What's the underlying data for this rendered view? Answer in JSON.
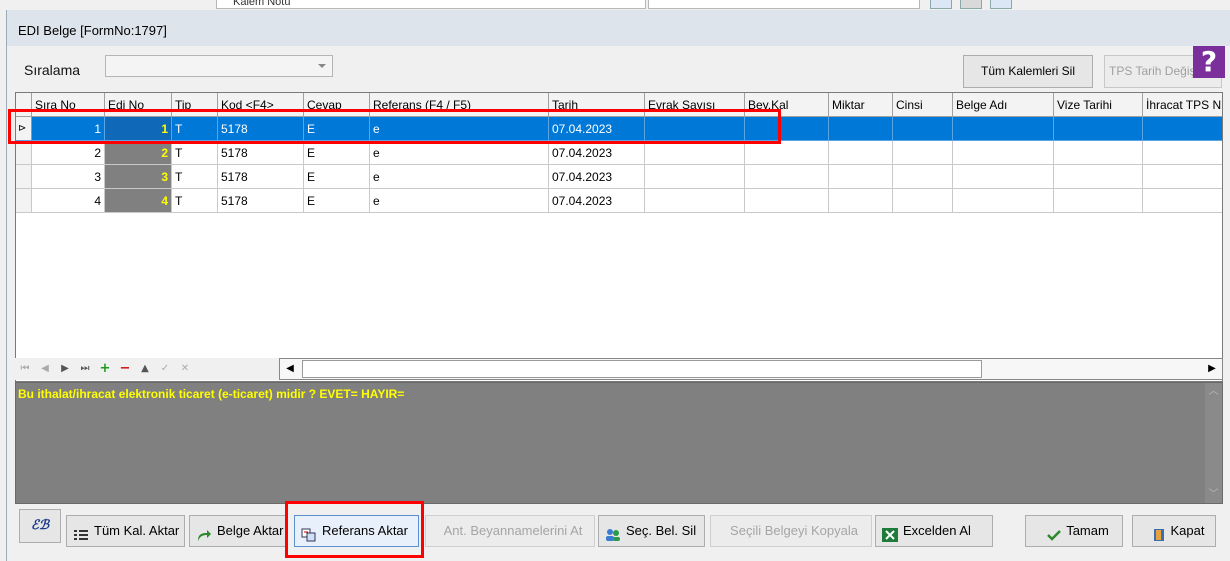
{
  "background_window": {
    "field_label": "Kalem Notu"
  },
  "window": {
    "title": "EDI Belge  [FormNo:1797]"
  },
  "toolbar": {
    "sort_label": "Sıralama",
    "sort_value": "",
    "delete_all_label": "Tüm Kalemleri Sil",
    "tps_label": "TPS Tarih Değiş",
    "help_label": "?"
  },
  "grid": {
    "columns": [
      "Sıra No",
      "Edi No",
      "Tip",
      "Kod <F4>",
      "Cevap",
      "Referans (F4 / F5)",
      "Tarih",
      "Evrak Sayısı",
      "Bey.Kal",
      "Miktar",
      "Cinsi",
      "Belge Adı",
      "Vize Tarihi",
      "İhracat TPS N"
    ],
    "rows": [
      {
        "sira": "1",
        "edi": "1",
        "tip": "T",
        "kod": "5178",
        "cevap": "E",
        "referans": "e",
        "tarih": "07.04.2023",
        "selected": true
      },
      {
        "sira": "2",
        "edi": "2",
        "tip": "T",
        "kod": "5178",
        "cevap": "E",
        "referans": "e",
        "tarih": "07.04.2023",
        "selected": false
      },
      {
        "sira": "3",
        "edi": "3",
        "tip": "T",
        "kod": "5178",
        "cevap": "E",
        "referans": "e",
        "tarih": "07.04.2023",
        "selected": false
      },
      {
        "sira": "4",
        "edi": "4",
        "tip": "T",
        "kod": "5178",
        "cevap": "E",
        "referans": "e",
        "tarih": "07.04.2023",
        "selected": false
      }
    ]
  },
  "message": {
    "text": "Bu ithalat/ihracat elektronik ticaret (e-ticaret) midir ? EVET= HAYIR="
  },
  "buttons": {
    "eb_label": "ℰℬ",
    "all_items_transfer": "Tüm Kal. Aktar",
    "doc_transfer": "Belge Aktar",
    "ref_transfer": "Referans Aktar",
    "ant_declarations": "Ant. Beyannamelerini At",
    "selected_delete": "Seç. Bel. Sil",
    "copy_selected": "Seçili Belgeyi Kopyala",
    "excel_import": "Excelden Al",
    "ok": "Tamam",
    "close": "Kapat"
  },
  "colors": {
    "selection": "#0078d7",
    "highlight": "#ff0000",
    "message_text": "#ffff00"
  }
}
